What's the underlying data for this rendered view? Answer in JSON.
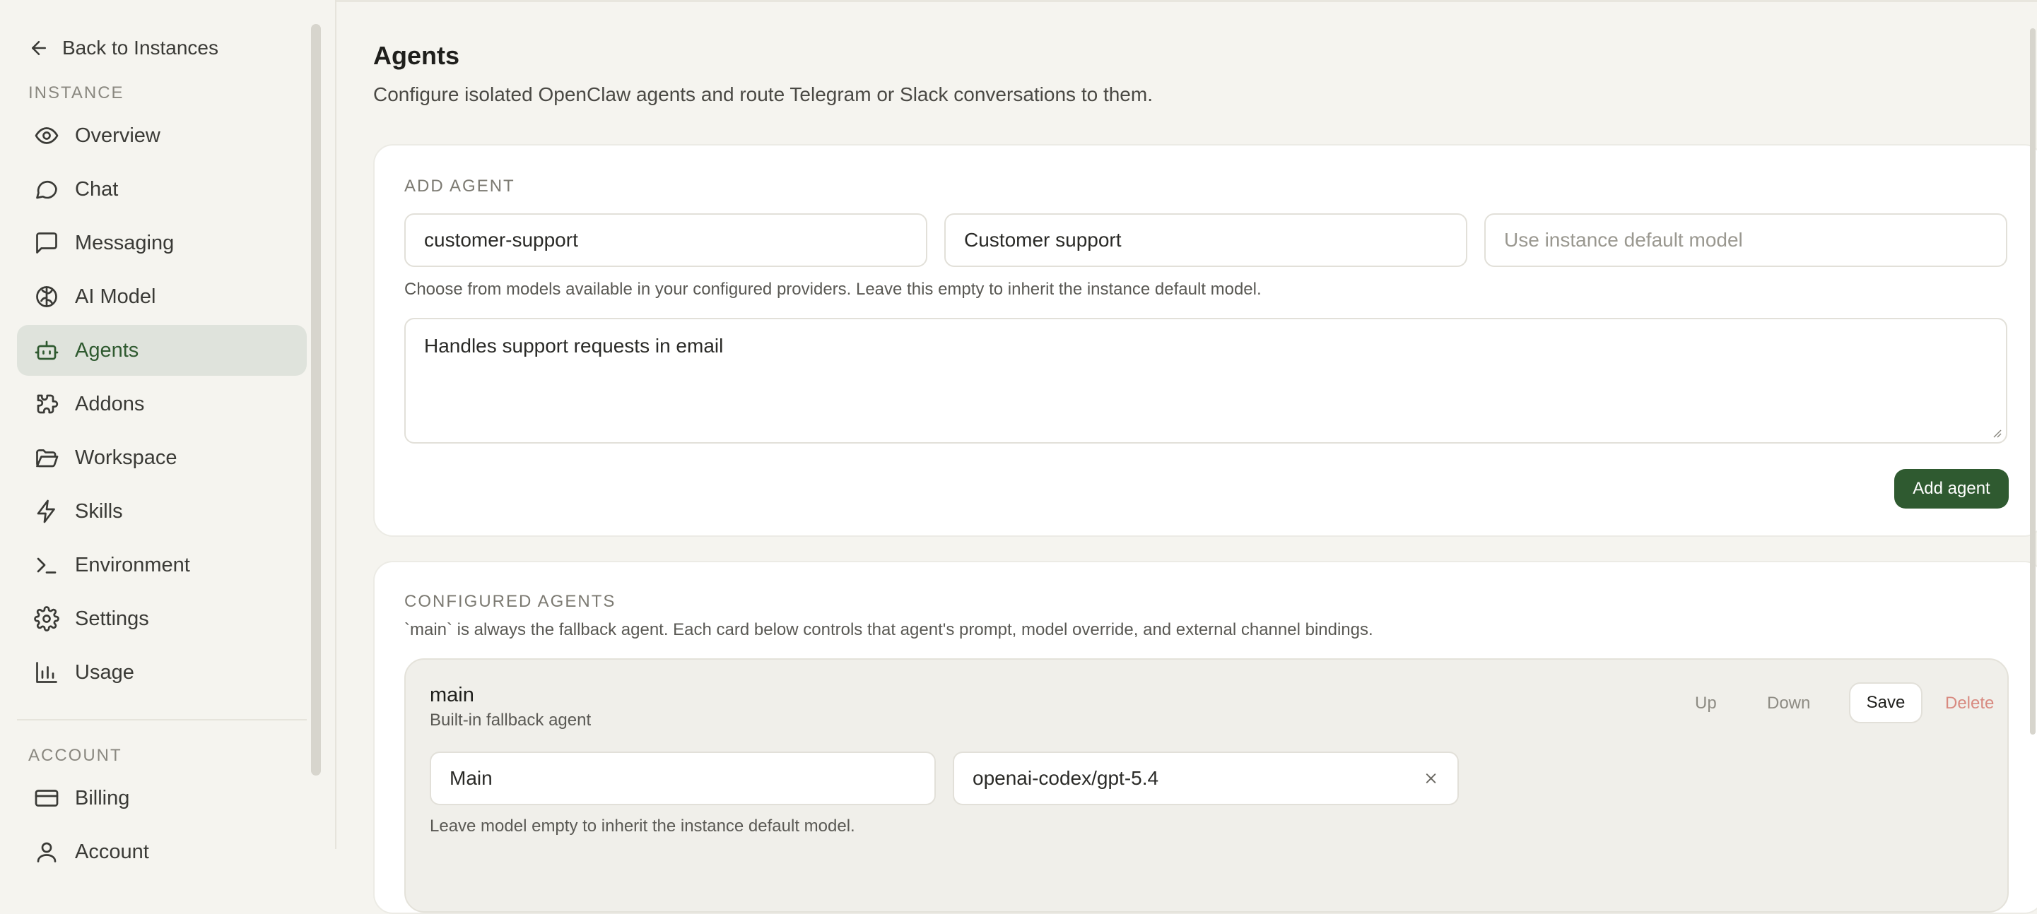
{
  "sidebar": {
    "back_label": "Back to Instances",
    "instance_label": "INSTANCE",
    "account_label": "ACCOUNT",
    "items": [
      {
        "label": "Overview",
        "icon": "eye-icon"
      },
      {
        "label": "Chat",
        "icon": "chat-bubble-icon"
      },
      {
        "label": "Messaging",
        "icon": "message-square-icon"
      },
      {
        "label": "AI Model",
        "icon": "brain-icon"
      },
      {
        "label": "Agents",
        "icon": "robot-icon",
        "active": true
      },
      {
        "label": "Addons",
        "icon": "puzzle-icon"
      },
      {
        "label": "Workspace",
        "icon": "folder-open-icon"
      },
      {
        "label": "Skills",
        "icon": "lightning-icon"
      },
      {
        "label": "Environment",
        "icon": "terminal-icon"
      },
      {
        "label": "Settings",
        "icon": "gear-icon"
      },
      {
        "label": "Usage",
        "icon": "bar-chart-icon"
      }
    ],
    "account_items": [
      {
        "label": "Billing",
        "icon": "credit-card-icon"
      },
      {
        "label": "Account",
        "icon": "user-icon"
      }
    ]
  },
  "page": {
    "title": "Agents",
    "description": "Configure isolated OpenClaw agents and route Telegram or Slack conversations to them."
  },
  "add_agent": {
    "section_label": "ADD AGENT",
    "id_value": "customer-support",
    "name_value": "Customer support",
    "model_placeholder": "Use instance default model",
    "model_helper": "Choose from models available in your configured providers. Leave this empty to inherit the instance default model.",
    "prompt_value": "Handles support requests in email",
    "add_button": "Add agent"
  },
  "configured": {
    "section_label": "CONFIGURED AGENTS",
    "description": "`main` is always the fallback agent. Each card below controls that agent's prompt, model override, and external channel bindings.",
    "agent": {
      "id": "main",
      "subtitle": "Built-in fallback agent",
      "up_label": "Up",
      "down_label": "Down",
      "save_label": "Save",
      "delete_label": "Delete",
      "name_value": "Main",
      "model_value": "openai-codex/gpt-5.4",
      "model_helper": "Leave model empty to inherit the instance default model."
    }
  },
  "colors": {
    "accent": "#2f5a30",
    "active_nav_bg": "#dfe3dc",
    "background": "#f5f4ef",
    "danger": "#d88a80"
  }
}
